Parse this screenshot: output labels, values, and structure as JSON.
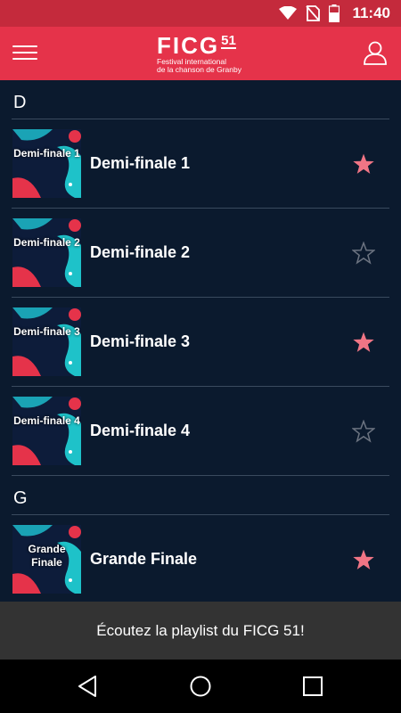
{
  "status_bar": {
    "time": "11:40"
  },
  "header": {
    "logo_main": "FICG",
    "logo_number": "51",
    "logo_line1": "Festival international",
    "logo_line2": "de la chanson de Granby"
  },
  "sections": [
    {
      "letter": "D",
      "items": [
        {
          "thumb_label": "Demi-finale 1",
          "title": "Demi-finale 1",
          "favorite": true
        },
        {
          "thumb_label": "Demi-finale 2",
          "title": "Demi-finale 2",
          "favorite": false
        },
        {
          "thumb_label": "Demi-finale 3",
          "title": "Demi-finale 3",
          "favorite": true
        },
        {
          "thumb_label": "Demi-finale 4",
          "title": "Demi-finale 4",
          "favorite": false
        }
      ]
    },
    {
      "letter": "G",
      "items": [
        {
          "thumb_label": "Grande Finale",
          "title": "Grande Finale",
          "favorite": true
        }
      ]
    }
  ],
  "banner": {
    "text": "Écoutez la playlist du FICG 51!"
  },
  "colors": {
    "brand_red": "#e5334a",
    "status_red": "#c42a3c",
    "background": "#0b1a2e",
    "star_filled": "#f07585",
    "star_empty": "#6b7380"
  },
  "icons": {
    "menu": "hamburger-icon",
    "profile": "user-icon",
    "favorite_on": "star-filled-icon",
    "favorite_off": "star-outline-icon",
    "nav_back": "back-triangle-icon",
    "nav_home": "home-circle-icon",
    "nav_recents": "recents-square-icon"
  }
}
